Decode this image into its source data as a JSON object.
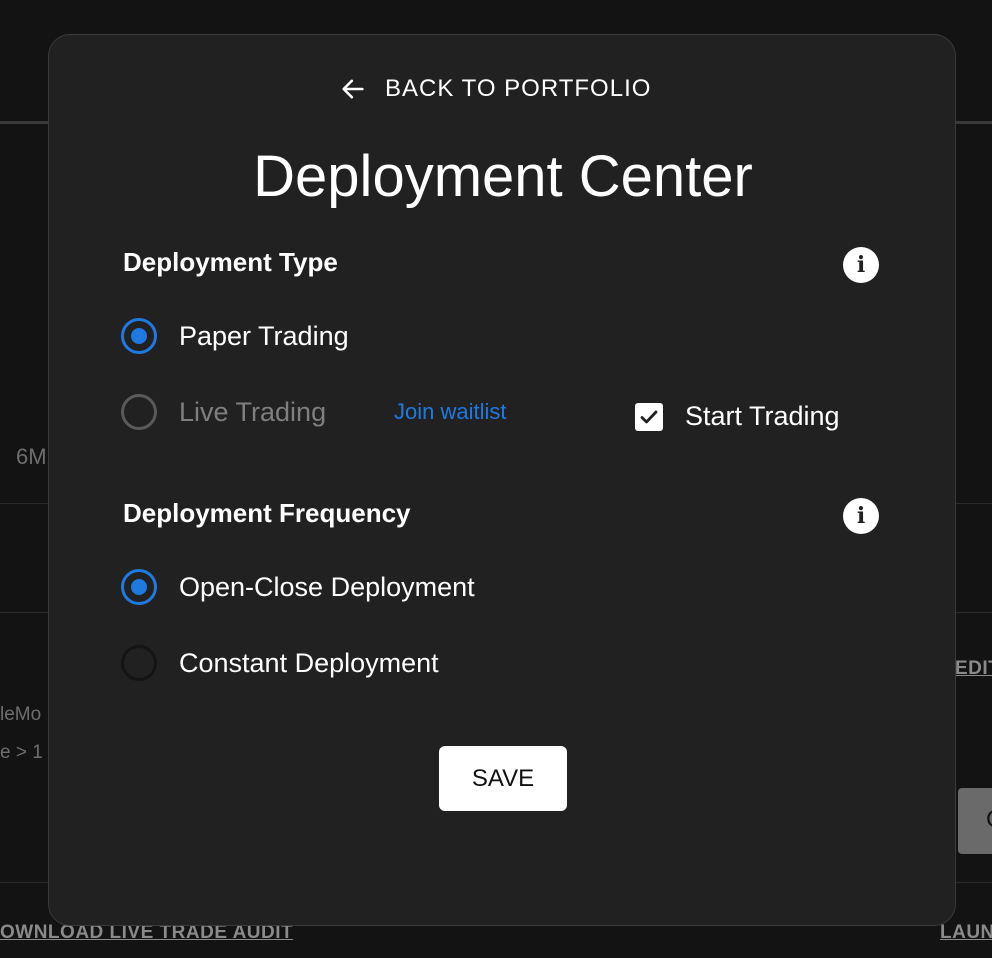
{
  "background": {
    "left_text_1": "6M",
    "left_text_2": "leMo",
    "left_text_3": "e > 1",
    "right_link": "EDIT",
    "bottom_left_link": "OWNLOAD LIVE TRADE AUDIT",
    "bottom_right_link": "LAUN",
    "right_button_text": "C"
  },
  "modal": {
    "back_label": "BACK TO PORTFOLIO",
    "title": "Deployment Center",
    "deployment_type": {
      "heading": "Deployment Type",
      "options": [
        {
          "label": "Paper Trading",
          "checked": true,
          "disabled": false
        },
        {
          "label": "Live Trading",
          "checked": false,
          "disabled": true
        }
      ],
      "waitlist_link": "Join waitlist",
      "start_trading": {
        "label": "Start Trading",
        "checked": true
      }
    },
    "deployment_frequency": {
      "heading": "Deployment Frequency",
      "options": [
        {
          "label": "Open-Close Deployment",
          "checked": true
        },
        {
          "label": "Constant Deployment",
          "checked": false
        }
      ]
    },
    "save_label": "SAVE"
  },
  "colors": {
    "accent": "#1e7ae0",
    "modal_bg": "#212121",
    "page_bg": "#131313"
  }
}
